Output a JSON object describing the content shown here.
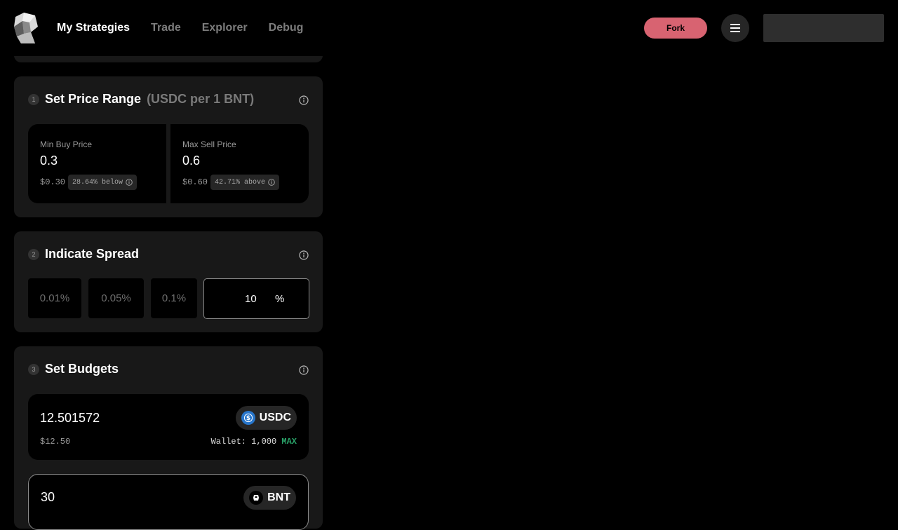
{
  "header": {
    "nav": [
      {
        "label": "My Strategies",
        "active": true
      },
      {
        "label": "Trade",
        "active": false
      },
      {
        "label": "Explorer",
        "active": false
      },
      {
        "label": "Debug",
        "active": false
      }
    ],
    "fork_label": "Fork"
  },
  "price_range": {
    "step": "1",
    "title": "Set Price Range",
    "subtitle": "(USDC per 1 BNT)",
    "min": {
      "label": "Min Buy Price",
      "value": "0.3",
      "usd": "$0.30",
      "badge": "28.64% below"
    },
    "max": {
      "label": "Max Sell Price",
      "value": "0.6",
      "usd": "$0.60",
      "badge": "42.71% above"
    }
  },
  "spread": {
    "step": "2",
    "title": "Indicate Spread",
    "options": [
      "0.01%",
      "0.05%",
      "0.1%"
    ],
    "custom_value": "10",
    "unit": "%"
  },
  "budgets": {
    "step": "3",
    "title": "Set Budgets",
    "items": [
      {
        "amount": "12.501572",
        "token": "USDC",
        "usd": "$12.50",
        "wallet_label": "Wallet: 1,000",
        "max_label": "MAX"
      },
      {
        "amount": "30",
        "token": "BNT"
      }
    ]
  },
  "colors": {
    "accent": "#d86371",
    "max_green": "#2aa46a",
    "usdc_blue": "#2775ca"
  }
}
